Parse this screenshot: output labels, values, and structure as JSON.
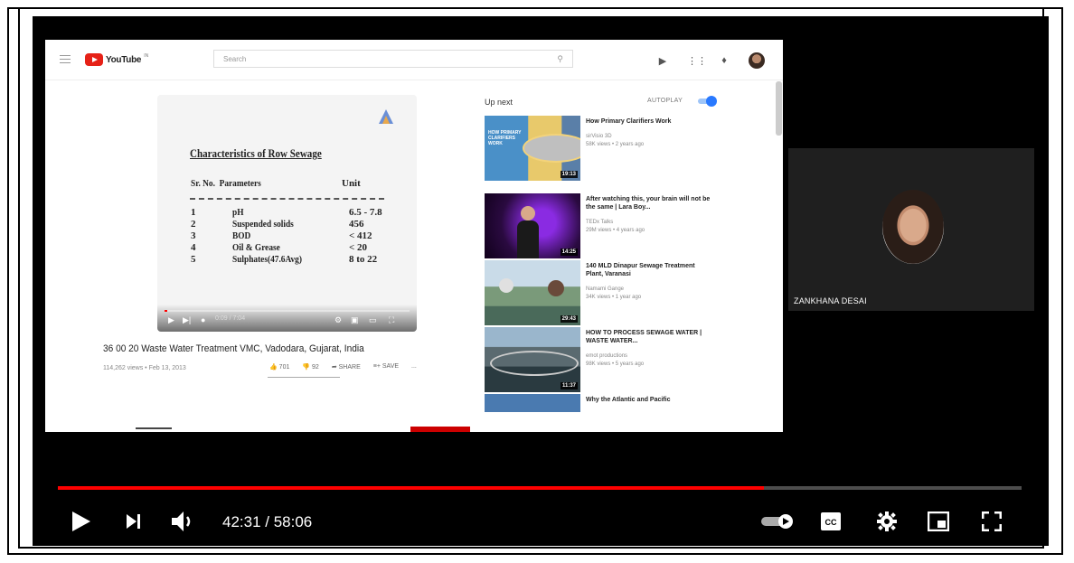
{
  "youtube": {
    "logo_text": "YouTube",
    "logo_sup": "IN",
    "search_placeholder": "Search",
    "icons": [
      "menu-icon",
      "search-icon",
      "video-camera-icon",
      "apps-grid-icon",
      "bell-icon",
      "avatar"
    ]
  },
  "slide": {
    "title": "Characteristics of Row Sewage",
    "col_no": "Sr. No.",
    "col_param": "Parameters",
    "col_unit": "Unit",
    "rows": [
      {
        "no": "1",
        "param": "pH",
        "unit": "6.5 - 7.8"
      },
      {
        "no": "2",
        "param": "Suspended solids",
        "unit": "456"
      },
      {
        "no": "3",
        "param": "BOD",
        "unit": "< 412"
      },
      {
        "no": "4",
        "param": "Oil & Grease",
        "unit": "< 20"
      },
      {
        "no": "5",
        "param": "Sulphates(47.6Avg)",
        "unit": "8 to 22"
      }
    ],
    "player_time": "0:09 / 7:04",
    "progress_fraction": 0.01
  },
  "video": {
    "title": "36 00 20 Waste Water Treatment VMC, Vadodara, Gujarat, India",
    "meta": "114,262 views • Feb 13, 2013",
    "likes": "701",
    "dislikes": "92",
    "share_label": "SHARE",
    "save_label": "SAVE",
    "more_label": "..."
  },
  "upnext": {
    "label": "Up next",
    "autoplay_label": "AUTOPLAY",
    "autoplay_on": true,
    "items": [
      {
        "title": "How Primary Clarifiers Work",
        "channel": "sirVisio 3D",
        "meta": "58K views • 2 years ago",
        "duration": "19:13",
        "thumb_text": "HOW PRIMARY CLARIFIERS WORK"
      },
      {
        "title": "After watching this, your brain will not be the same | Lara Boy...",
        "channel": "TEDx Talks",
        "meta": "29M views • 4 years ago",
        "duration": "14:25"
      },
      {
        "title": "140 MLD Dinapur Sewage Treatment Plant, Varanasi",
        "channel": "Namami Gange",
        "meta": "34K views • 1 year ago",
        "duration": "29:43"
      },
      {
        "title": "HOW TO PROCESS SEWAGE WATER | WASTE WATER...",
        "channel": "emot productions",
        "meta": "98K views • 5 years ago",
        "duration": "11:37"
      },
      {
        "title": "Why the Atlantic and Pacific"
      }
    ]
  },
  "participant": {
    "name": "ZANKHANA DESAI"
  },
  "player": {
    "current_time": "42:31",
    "duration": "58:06",
    "time_display": "42:31 / 58:06",
    "progress_fraction": 0.733,
    "colors": {
      "progress": "#ff0000"
    }
  }
}
